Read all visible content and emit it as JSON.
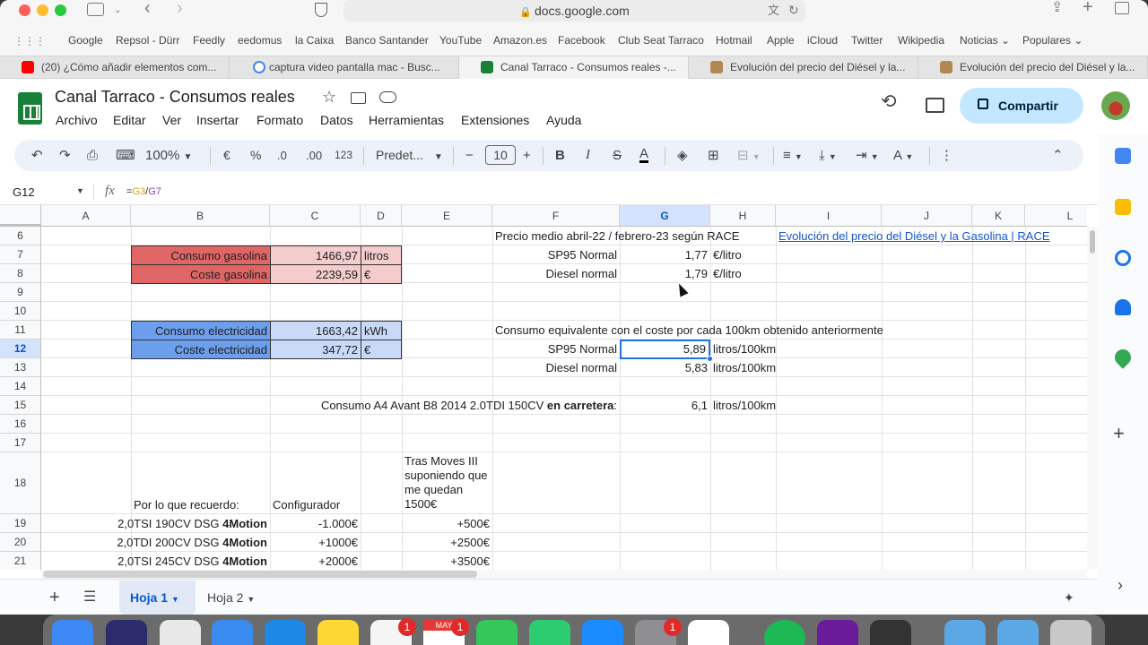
{
  "browser": {
    "url": "docs.google.com",
    "bookmarks": [
      "Google",
      "Repsol - Dürr",
      "Feedly",
      "eedomus",
      "la Caixa",
      "Banco Santander",
      "YouTube",
      "Amazon.es",
      "Facebook",
      "Club Seat Tarraco",
      "Hotmail",
      "Apple",
      "iCloud",
      "Twitter",
      "Wikipedia",
      "Noticias",
      "Populares"
    ],
    "tabs": [
      {
        "title": "(20) ¿Cómo añadir elementos com...",
        "color": "#ff0000"
      },
      {
        "title": "captura video pantalla mac - Busc...",
        "color": "#4285f4"
      },
      {
        "title": "Canal Tarraco - Consumos reales -...",
        "color": "#188038"
      },
      {
        "title": "Evolución del precio del Diésel y la...",
        "color": "#b08850"
      },
      {
        "title": "Evolución del precio del Diésel y la...",
        "color": "#b08850"
      }
    ]
  },
  "doc": {
    "title": "Canal Tarraco -  Consumos reales",
    "menu": [
      "Archivo",
      "Editar",
      "Ver",
      "Insertar",
      "Formato",
      "Datos",
      "Herramientas",
      "Extensiones",
      "Ayuda"
    ],
    "share_label": "Compartir"
  },
  "toolbar": {
    "zoom": "100%",
    "currency": "€",
    "percent": "%",
    "dec_down": ".0",
    "dec_up": ".00",
    "number_format": "123",
    "font": "Predet...",
    "font_size": "10"
  },
  "formula_bar": {
    "cell_ref": "G12",
    "formula_prefix": "=",
    "formula_g3": "G3",
    "formula_slash": "/",
    "formula_g7": "G7"
  },
  "columns": [
    "A",
    "B",
    "C",
    "D",
    "E",
    "F",
    "G",
    "H",
    "I",
    "J",
    "K",
    "L"
  ],
  "rows": [
    "6",
    "7",
    "8",
    "9",
    "10",
    "11",
    "12",
    "13",
    "14",
    "15",
    "16",
    "17",
    "18",
    "19",
    "20",
    "21"
  ],
  "cells": {
    "f6": "Precio medio abril-22 / febrero-23 según RACE",
    "i6_link": "Evolución del precio del Diésel y la Gasolina | RACE",
    "b7": "Consumo gasolina",
    "c7": "1466,97",
    "d7": "litros",
    "f7": "SP95 Normal",
    "g7": "1,77",
    "h7": "€/litro",
    "b8": "Coste gasolina",
    "c8": "2239,59",
    "d8": "€",
    "f8": "Diesel normal",
    "g8": "1,79",
    "h8": "€/litro",
    "b11": "Consumo electricidad",
    "c11": "1663,42",
    "d11": "kWh",
    "f11": "Consumo equivalente con el coste por cada 100km obtenido anteriormente",
    "b12": "Coste electricidad",
    "c12": "347,72",
    "d12": "€",
    "f12": "SP95 Normal",
    "g12": "5,89",
    "h12": "litros/100km",
    "f13": "Diesel normal",
    "g13": "5,83",
    "h13": "litros/100km",
    "e15_a": "Consumo A4 Avant B8 2014 2.0TDI 150CV ",
    "e15_b": "en carretera",
    "e15_c": ":",
    "g15": "6,1",
    "h15": "litros/100km",
    "b18": "Por lo que recuerdo:",
    "c18": "Configurador",
    "e18": "Tras Moves III suponiendo que me quedan 1500€",
    "b19_a": "2,0TSI 190CV DSG ",
    "b19_b": "4Motion",
    "c19": "-1.000€",
    "e19": "+500€",
    "b20_a": "2,0TDI 200CV DSG ",
    "b20_b": "4Motion",
    "c20": "+1000€",
    "e20": "+2500€",
    "b21_a": "2,0TSI 245CV DSG ",
    "b21_b": "4Motion",
    "c21": "+2000€",
    "e21": "+3500€"
  },
  "sheets": [
    "Hoja 1",
    "Hoja 2"
  ],
  "dock_badges": [
    "1",
    "1",
    "1",
    "1"
  ],
  "dock_calendar_month": "MAY"
}
